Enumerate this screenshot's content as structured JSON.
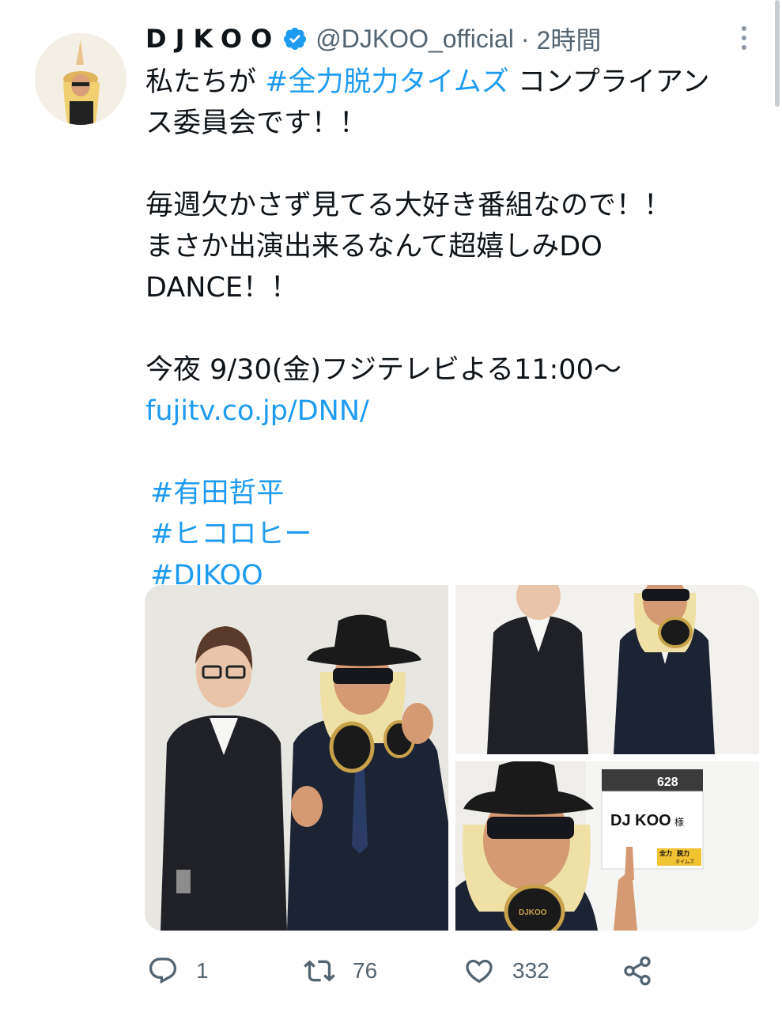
{
  "tweet": {
    "display_name": "DJKOO",
    "handle": "@DJKOO_official",
    "separator": "·",
    "time": "2時間",
    "text": {
      "l1_pre": "私たちが ",
      "l1_hashtag": "#全力脱力タイムズ",
      "l1_post": " コンプライアン",
      "l2": "ス委員会です！！",
      "l3": "毎週欠かさず見てる大好き番組なので！！",
      "l4": "まさか出演出来るなんて超嬉しみDO",
      "l5": "DANCE！！",
      "l6": "今夜 9/30(金)フジテレビよる11:00〜",
      "link": "fujitv.co.jp/DNN/",
      "hashtags": [
        "#有田哲平",
        "#ヒコロヒー",
        "#DJKOO"
      ]
    },
    "photo_sign": {
      "room": "628",
      "name": "DJ KOO",
      "honorific": "様",
      "logo_top": "全力",
      "logo_mid": "脱力",
      "logo_bottom": "タイムズ",
      "headphone_brand": "DJKOO"
    },
    "actions": {
      "replies": "1",
      "retweets": "76",
      "likes": "332"
    }
  },
  "colors": {
    "accent": "#1d9bf0",
    "secondary_text": "#536471",
    "primary_text": "#0f1419"
  },
  "icons": [
    "verified-badge-icon",
    "more-icon",
    "reply-icon",
    "retweet-icon",
    "like-icon",
    "share-icon"
  ]
}
